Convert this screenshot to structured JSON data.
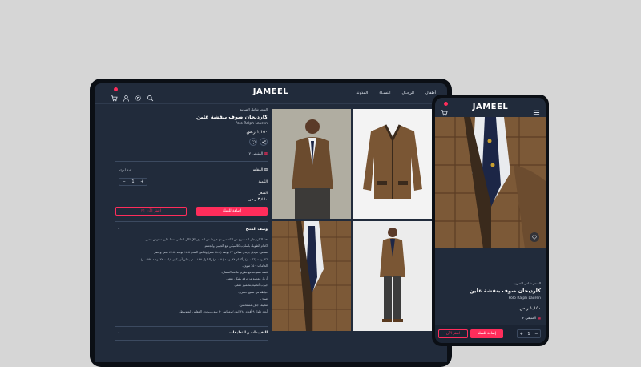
{
  "brand": "JAMEEL",
  "nav": {
    "items": [
      "أطفال",
      "الرجـال",
      "النسـاء",
      "المدونة"
    ]
  },
  "product": {
    "breadcrumb": "السعر شامل الضريبة",
    "title": "كارديجان صوف بنقشة غلين",
    "brand": "Polo Ralph Lauren",
    "price": "١,١٥٠ ر.س",
    "stock": "المتبقي ٧",
    "size_label": "المقاس",
    "size_value": "٣-٤ أعوام",
    "quantity_label": "الكمية",
    "quantity": "1",
    "total_label": "السعر",
    "total_value": "٣,٤٥٠ ر.س",
    "add_to_cart": "إضافة للسلة",
    "buy_now": "اشترِ الآن",
    "description_title": "وصف المنتج",
    "description_lines": [
      "هذا الكارديجان المنسوج من الكشمير مع خيوط من الصوف الإيطالي الفاخر بنمط غلين منقوش جميل.",
      "أكمام الطويلة بأسلوب كلاسيكي مع الجيبين والجسم.",
      "مقاس: موديل يرتدي مقاس ٢٣ بوصة (٥٨.٤ سم) وقياس الصدر ١٧.٥ بوصة (٤٤.٥ سم) وخصر",
      "٢٦ بوصة (٦٦ سم) وأكمام ٢٨ بوصة (٧١ سم) والطول ١٢٧ سم. يمكن أن يكون قياسه ٢٧ بوصة (٥٩ سم).",
      "الخامات: ٥٠٪ صوف.",
      "قصة مفتوحة مع تطريز علامة الحصان.",
      "أزرار معدنية مزخرفة بشكل متقن.",
      "جيوب أمامية بتصميم عملي.",
      "خياطة من نسيج حصري.",
      "صوف.",
      "تنظيف جاف مستحسن.",
      "أبعاد طول ٩ أقدام (٢٨ إنش) ومقاس ٣٠ سم، ويرتدي المقاس المتوسط."
    ],
    "reviews_title": "التقييمات و التعليقات"
  },
  "icons": {
    "cart": "cart-icon",
    "user": "user-icon",
    "settings": "gear-icon",
    "search": "search-icon",
    "share": "share-icon",
    "wishlist": "heart-icon",
    "menu": "menu-icon"
  },
  "colors": {
    "background": "#d6d6d6",
    "device": "#0b0f15",
    "screen": "#212b3b",
    "accent": "#ff2d5b",
    "text": "#e8ecf2"
  }
}
